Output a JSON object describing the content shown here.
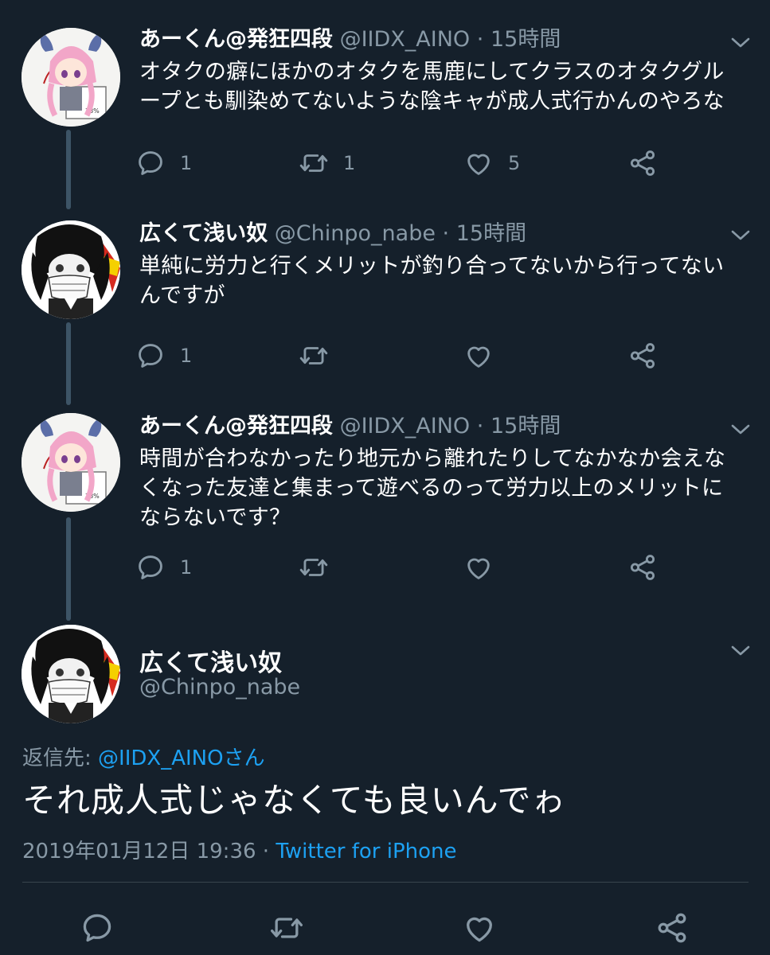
{
  "colors": {
    "background": "#15202b",
    "primary_text": "#ffffff",
    "secondary_text": "#8899a6",
    "link": "#1da1f2",
    "thread_line": "#3d5466"
  },
  "tweets": [
    {
      "name": "あーくん@発狂四段",
      "handle": "@IIDX_AINO",
      "dot": "·",
      "time": "15時間",
      "text": "オタクの癖にほかのオタクを馬鹿にしてクラスのオタクグループとも馴染めてないような陰キャが成人式行かんのやろな",
      "reply_count": "1",
      "retweet_count": "1",
      "like_count": "5",
      "avatar_icon": "anime-girl-pink-hair-avatar"
    },
    {
      "name": "広くて浅い奴",
      "handle": "@Chinpo_nabe",
      "dot": "·",
      "time": "15時間",
      "text": "単純に労力と行くメリットが釣り合ってないから行ってないんですが",
      "reply_count": "1",
      "retweet_count": "",
      "like_count": "",
      "avatar_icon": "masked-boy-avatar"
    },
    {
      "name": "あーくん@発狂四段",
      "handle": "@IIDX_AINO",
      "dot": "·",
      "time": "15時間",
      "text": "時間が合わなかったり地元から離れたりしてなかなか会えなくなった友達と集まって遊べるのって労力以上のメリットにならないです？",
      "reply_count": "1",
      "retweet_count": "",
      "like_count": "",
      "avatar_icon": "anime-girl-pink-hair-avatar"
    }
  ],
  "main_tweet": {
    "name": "広くて浅い奴",
    "handle": "@Chinpo_nabe",
    "reply_prefix": "返信先: ",
    "reply_target": "@IIDX_AINOさん",
    "text": "それ成人式じゃなくても良いんでゎ",
    "timestamp": "2019年01月12日 19:36",
    "meta_dot": "·",
    "source": "Twitter for iPhone"
  }
}
